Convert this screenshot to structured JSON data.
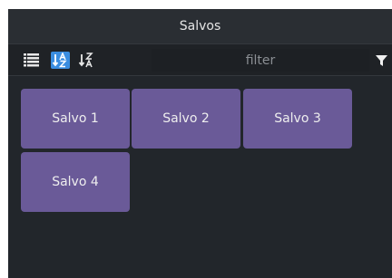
{
  "panel": {
    "title": "Salvos"
  },
  "toolbar": {
    "list_view_icon": "list-view-icon",
    "sort_az_icon": "sort-a-z-icon",
    "sort_za_icon": "sort-z-a-icon",
    "filter_placeholder": "filter",
    "filter_value": "",
    "filter_icon": "funnel-icon",
    "active_sort_color": "#3a8de0"
  },
  "salvos": [
    {
      "label": "Salvo 1"
    },
    {
      "label": "Salvo 2"
    },
    {
      "label": "Salvo 3"
    },
    {
      "label": "Salvo 4"
    }
  ],
  "colors": {
    "panel_bg": "#22262b",
    "tile_bg": "#6a5a98"
  }
}
